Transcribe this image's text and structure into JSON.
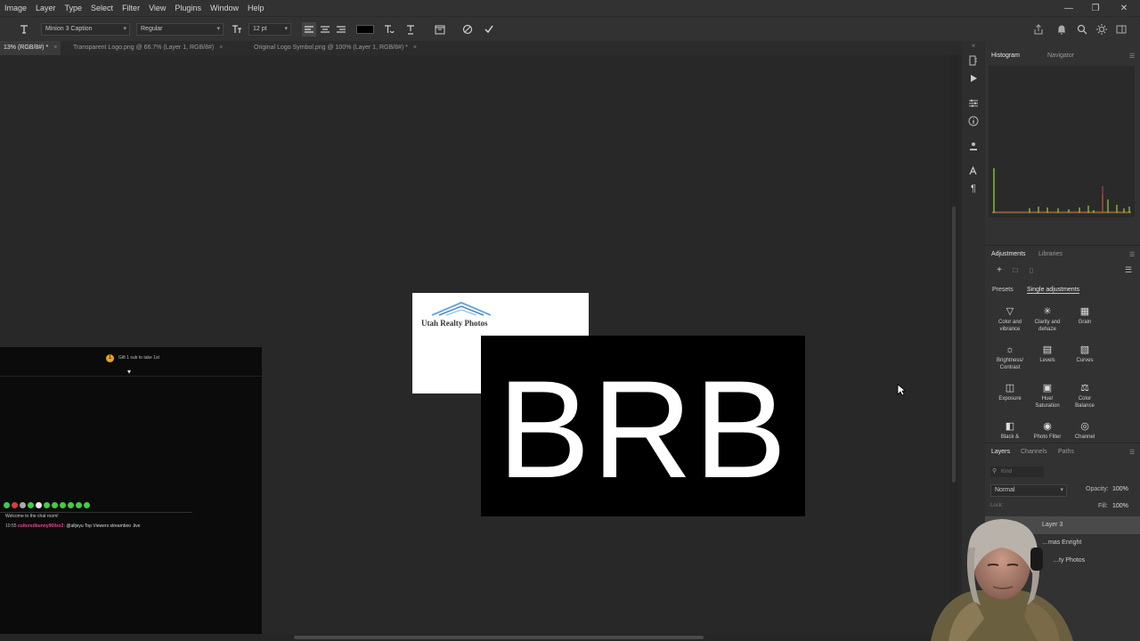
{
  "menu": [
    "Image",
    "Layer",
    "Type",
    "Select",
    "Filter",
    "View",
    "Plugins",
    "Window",
    "Help"
  ],
  "window_controls": {
    "minimize": "—",
    "restore": "❐",
    "close": "✕"
  },
  "options_bar": {
    "font_family": "Minion 3 Caption",
    "font_style": "Regular",
    "font_size": "12 pt",
    "text_color": "#000000"
  },
  "tabs": [
    {
      "label": "13% (RGB/8#) *",
      "active": true
    },
    {
      "label": "Transparent Logo.png @ 66.7% (Layer 1, RGB/8#)",
      "active": false
    },
    {
      "label": "Original Logo Symbol.png @ 100% (Layer 1, RGB/8#) *",
      "active": false
    }
  ],
  "document": {
    "logo_text": "Utah Realty Photos",
    "brb_text": "BRB"
  },
  "stream_overlay": {
    "gift_text": "Gift 1 sub to take 1st",
    "welcome": "Welcome to the chat room!",
    "chat": [
      {
        "time": "10:55",
        "user": "culturedbunny969xx2:",
        "message": "@alljeyu Top Viewers streamboo .live"
      }
    ]
  },
  "panels": {
    "histogram_tabs": [
      "Histogram",
      "Navigator"
    ],
    "adjustments_tabs": [
      "Adjustments",
      "Libraries"
    ],
    "adjustments_subtabs": [
      "Presets",
      "Single adjustments"
    ],
    "adjustments": [
      {
        "label1": "Color and",
        "label2": "vibrance",
        "icon": "triangle-icon"
      },
      {
        "label1": "Clarity and",
        "label2": "dehaze",
        "icon": "sparkle-icon"
      },
      {
        "label1": "Grain",
        "label2": "",
        "icon": "grain-icon"
      },
      {
        "label1": "Brightness/",
        "label2": "Contrast",
        "icon": "sun-icon"
      },
      {
        "label1": "Levels",
        "label2": "",
        "icon": "levels-icon"
      },
      {
        "label1": "Curves",
        "label2": "",
        "icon": "curves-icon"
      },
      {
        "label1": "Exposure",
        "label2": "",
        "icon": "exposure-icon"
      },
      {
        "label1": "Hue/",
        "label2": "Saturation",
        "icon": "hue-icon"
      },
      {
        "label1": "Color",
        "label2": "Balance",
        "icon": "balance-icon"
      },
      {
        "label1": "Black &",
        "label2": "",
        "icon": "bw-icon"
      },
      {
        "label1": "Photo Filter",
        "label2": "",
        "icon": "camera-icon"
      },
      {
        "label1": "Channel",
        "label2": "",
        "icon": "channel-icon"
      }
    ],
    "layers_tabs": [
      "Layers",
      "Channels",
      "Paths"
    ],
    "layers_search_placeholder": "Kind",
    "blend_mode": "Normal",
    "opacity_label": "Opacity:",
    "opacity_value": "100%",
    "lock_label": "Lock:",
    "fill_label": "Fill:",
    "fill_value": "100%",
    "layers": [
      "Layer 3",
      "…mas Enright",
      "…ty Photos"
    ]
  }
}
